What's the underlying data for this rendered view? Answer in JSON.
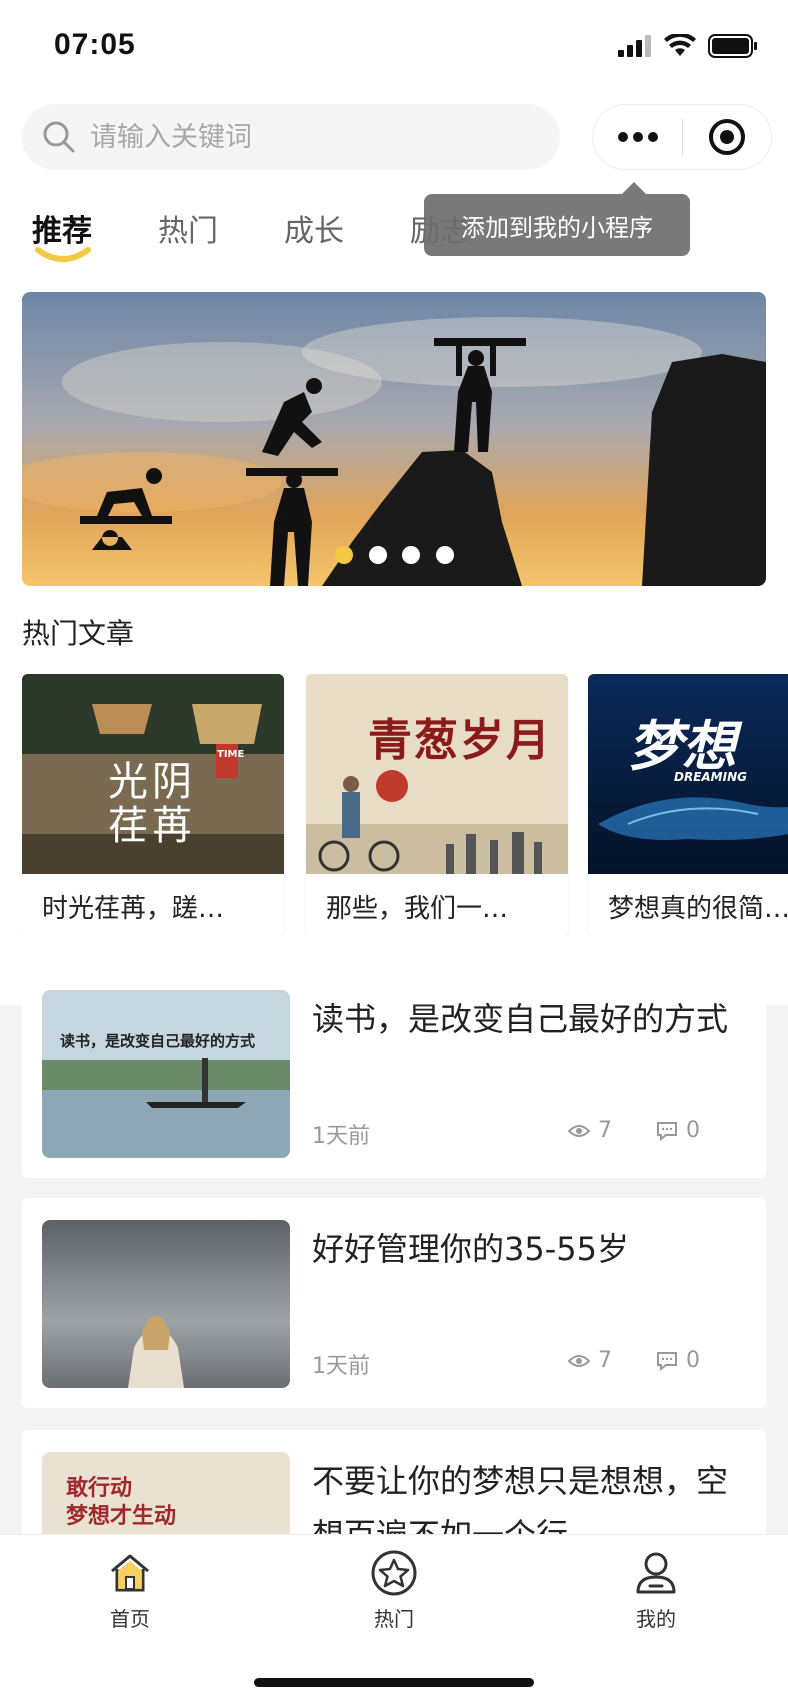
{
  "status_bar": {
    "time": "07:05"
  },
  "search": {
    "placeholder": "请输入关键词"
  },
  "tabs": [
    {
      "label": "推荐",
      "active": true
    },
    {
      "label": "热门"
    },
    {
      "label": "成长"
    },
    {
      "label": "励志"
    }
  ],
  "tooltip": {
    "text": "添加到我的小程序"
  },
  "banner": {
    "slides": 4,
    "active_index": 0
  },
  "hot_section": {
    "title": "热门文章",
    "cards": [
      {
        "title": "时光荏苒，蹉…",
        "image_text": "光阴荏苒",
        "image_badge": "TIME"
      },
      {
        "title": "那些，我们一…",
        "image_text": "青葱岁月"
      },
      {
        "title": "梦想真的很简…",
        "image_text": "梦想",
        "image_sub": "DREAMING"
      }
    ]
  },
  "articles": [
    {
      "title": "读书，是改变自己最好的方式",
      "image_text": "读书，是改变自己最好的方式",
      "time": "1天前",
      "views": "7",
      "comments": "0"
    },
    {
      "title": "好好管理你的35-55岁",
      "time": "1天前",
      "views": "7",
      "comments": "0"
    },
    {
      "title": "不要让你的梦想只是想想，空想百遍不如一个行",
      "image_text_1": "敢行动",
      "image_text_2": "梦想才生动"
    }
  ],
  "tabbar": [
    {
      "label": "首页",
      "icon": "home-icon"
    },
    {
      "label": "热门",
      "icon": "star-icon"
    },
    {
      "label": "我的",
      "icon": "user-icon"
    }
  ],
  "colors": {
    "accent": "#f3c944",
    "text": "#222222",
    "muted": "#999999",
    "background": "#f4f4f4"
  }
}
